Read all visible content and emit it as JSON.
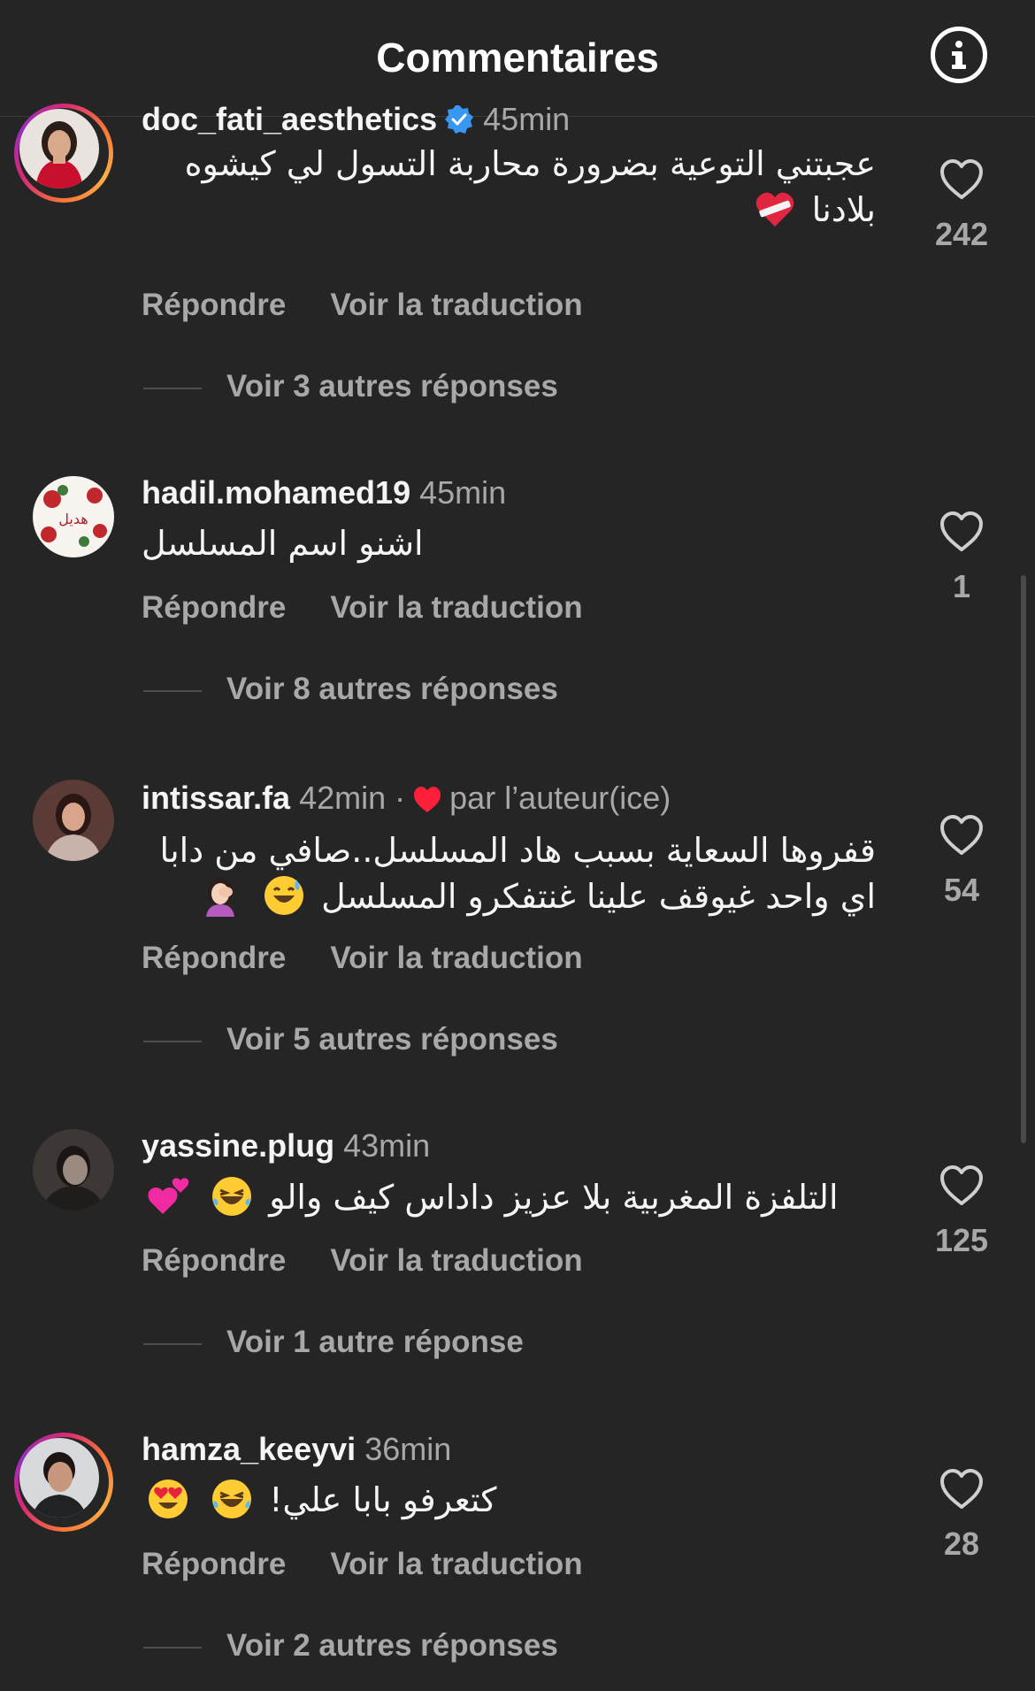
{
  "header": {
    "title": "Commentaires",
    "info_icon": "info-icon"
  },
  "actions": {
    "reply": "Répondre",
    "translate": "Voir la traduction"
  },
  "comments": [
    {
      "username": "doc_fati_aesthetics",
      "verified": true,
      "time": "45min",
      "text": "عجبتني التوعية بضرورة محاربة التسول لي كيشوه بلادنا",
      "emojis": [
        "mending-heart-emoji"
      ],
      "likes": "242",
      "replies": "Voir 3 autres réponses",
      "has_story_ring": true
    },
    {
      "username": "hadil.mohamed19",
      "time": "45min",
      "text": "اشنو اسم المسلسل",
      "likes": "1",
      "replies": "Voir 8 autres réponses"
    },
    {
      "username": "intissar.fa",
      "time": "42min",
      "separator": "·",
      "author_like": "par l’auteur(ice)",
      "text": "قفروها السعاية بسبب هاد المسلسل..صافي من دابا اي واحد غيوقف علينا غنتفكرو المسلسل",
      "emojis": [
        "sweat-smile-emoji",
        "facepalm-emoji"
      ],
      "likes": "54",
      "replies": "Voir 5 autres réponses"
    },
    {
      "username": "yassine.plug",
      "time": "43min",
      "text": "التلفزة المغربية بلا عزيز داداس كيف والو",
      "emojis": [
        "joy-emoji",
        "two-hearts-emoji"
      ],
      "likes": "125",
      "replies": "Voir 1 autre réponse"
    },
    {
      "username": "hamza_keeyvi",
      "time": "36min",
      "text": "كتعرفو بابا علي!",
      "emojis": [
        "joy-emoji",
        "heart-eyes-emoji"
      ],
      "likes": "28",
      "replies": "Voir 2 autres réponses",
      "has_story_ring": true
    }
  ]
}
